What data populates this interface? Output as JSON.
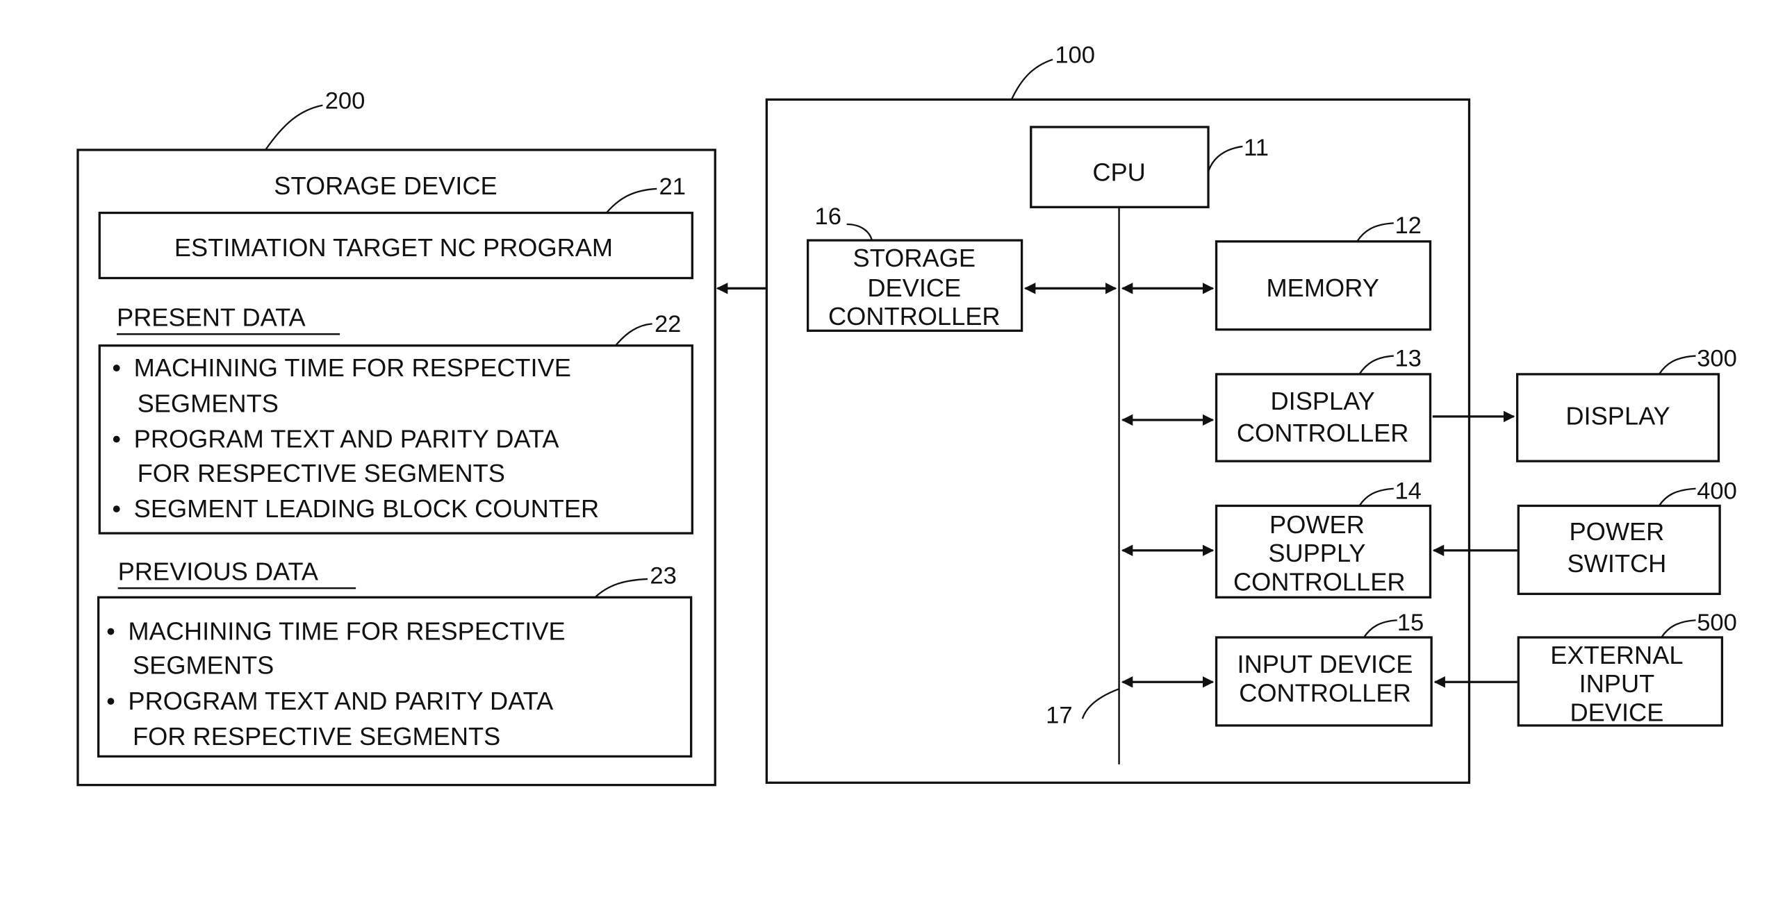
{
  "figure": {
    "storage_device": {
      "ref": "200",
      "title": "STORAGE DEVICE",
      "program_box": {
        "ref": "21",
        "label": "ESTIMATION TARGET NC PROGRAM"
      },
      "present_data": {
        "heading": "PRESENT DATA",
        "ref": "22",
        "items": [
          {
            "bullet": "•",
            "lines": [
              "MACHINING TIME FOR RESPECTIVE",
              "SEGMENTS"
            ]
          },
          {
            "bullet": "•",
            "lines": [
              "PROGRAM TEXT AND PARITY DATA",
              "FOR RESPECTIVE SEGMENTS"
            ]
          },
          {
            "bullet": "•",
            "lines": [
              "SEGMENT LEADING BLOCK COUNTER"
            ]
          }
        ]
      },
      "previous_data": {
        "heading": "PREVIOUS DATA",
        "ref": "23",
        "items": [
          {
            "bullet": "•",
            "lines": [
              "MACHINING TIME FOR RESPECTIVE",
              "SEGMENTS"
            ]
          },
          {
            "bullet": "•",
            "lines": [
              "PROGRAM TEXT AND PARITY DATA",
              "FOR RESPECTIVE SEGMENTS"
            ]
          }
        ]
      }
    },
    "controller_unit": {
      "ref": "100",
      "bus_ref": "17",
      "cpu": {
        "ref": "11",
        "label": "CPU"
      },
      "memory": {
        "ref": "12",
        "label": "MEMORY"
      },
      "display_controller": {
        "ref": "13",
        "lines": [
          "DISPLAY",
          "CONTROLLER"
        ]
      },
      "power_supply_controller": {
        "ref": "14",
        "lines": [
          "POWER",
          "SUPPLY",
          "CONTROLLER"
        ]
      },
      "input_device_controller": {
        "ref": "15",
        "lines": [
          "INPUT DEVICE",
          "CONTROLLER"
        ]
      },
      "storage_device_controller": {
        "ref": "16",
        "lines": [
          "STORAGE",
          "DEVICE",
          "CONTROLLER"
        ]
      }
    },
    "external": {
      "display": {
        "ref": "300",
        "label": "DISPLAY"
      },
      "power_switch": {
        "ref": "400",
        "lines": [
          "POWER",
          "SWITCH"
        ]
      },
      "external_input_device": {
        "ref": "500",
        "lines": [
          "EXTERNAL",
          "INPUT",
          "DEVICE"
        ]
      }
    }
  }
}
